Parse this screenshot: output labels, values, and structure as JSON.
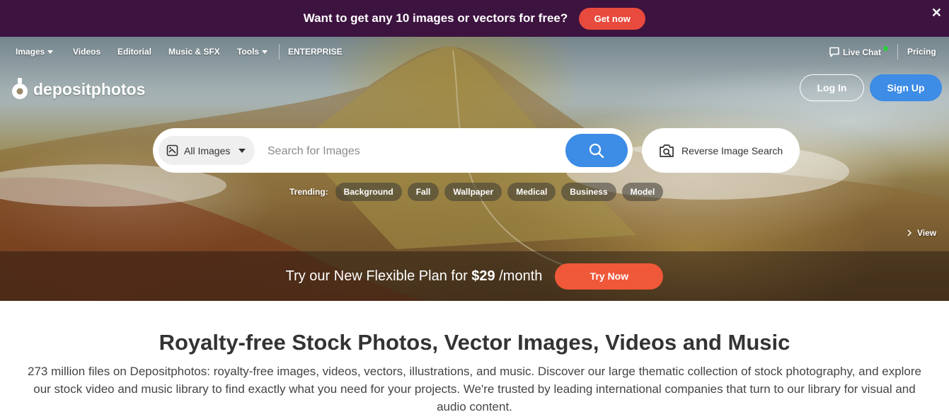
{
  "promo": {
    "text": "Want to get any 10 images or vectors for free?",
    "button": "Get now",
    "close_icon": "close-icon"
  },
  "nav": {
    "left": [
      {
        "label": "Images",
        "dropdown": true
      },
      {
        "label": "Videos"
      },
      {
        "label": "Editorial"
      },
      {
        "label": "Music & SFX"
      },
      {
        "label": "Tools",
        "dropdown": true
      },
      {
        "label": "ENTERPRISE"
      }
    ],
    "live_chat": "Live Chat",
    "pricing": "Pricing"
  },
  "logo": {
    "text": "depositphotos"
  },
  "auth": {
    "login": "Log In",
    "signup": "Sign Up"
  },
  "search": {
    "category": "All Images",
    "placeholder": "Search for Images",
    "reverse_label": "Reverse Image Search"
  },
  "trending": {
    "label": "Trending:",
    "tags": [
      "Background",
      "Fall",
      "Wallpaper",
      "Medical",
      "Business",
      "Model"
    ]
  },
  "hero": {
    "view_label": "View"
  },
  "plan": {
    "prefix": "Try our New Flexible Plan for",
    "price": "$29",
    "suffix": "/month",
    "button": "Try Now"
  },
  "content": {
    "title": "Royalty-free Stock Photos, Vector Images, Videos and Music",
    "description": "273 million files on Depositphotos: royalty-free images, videos, vectors, illustrations, and music. Discover our large thematic collection of stock photography, and explore our stock video and music library to find exactly what you need for your projects. We're trusted by leading international companies that turn to our library for visual and audio content."
  },
  "colors": {
    "promo_bg": "#3d1340",
    "accent_red": "#e84a3d",
    "accent_blue": "#3d8ce6",
    "online_dot": "#2ecc40"
  }
}
